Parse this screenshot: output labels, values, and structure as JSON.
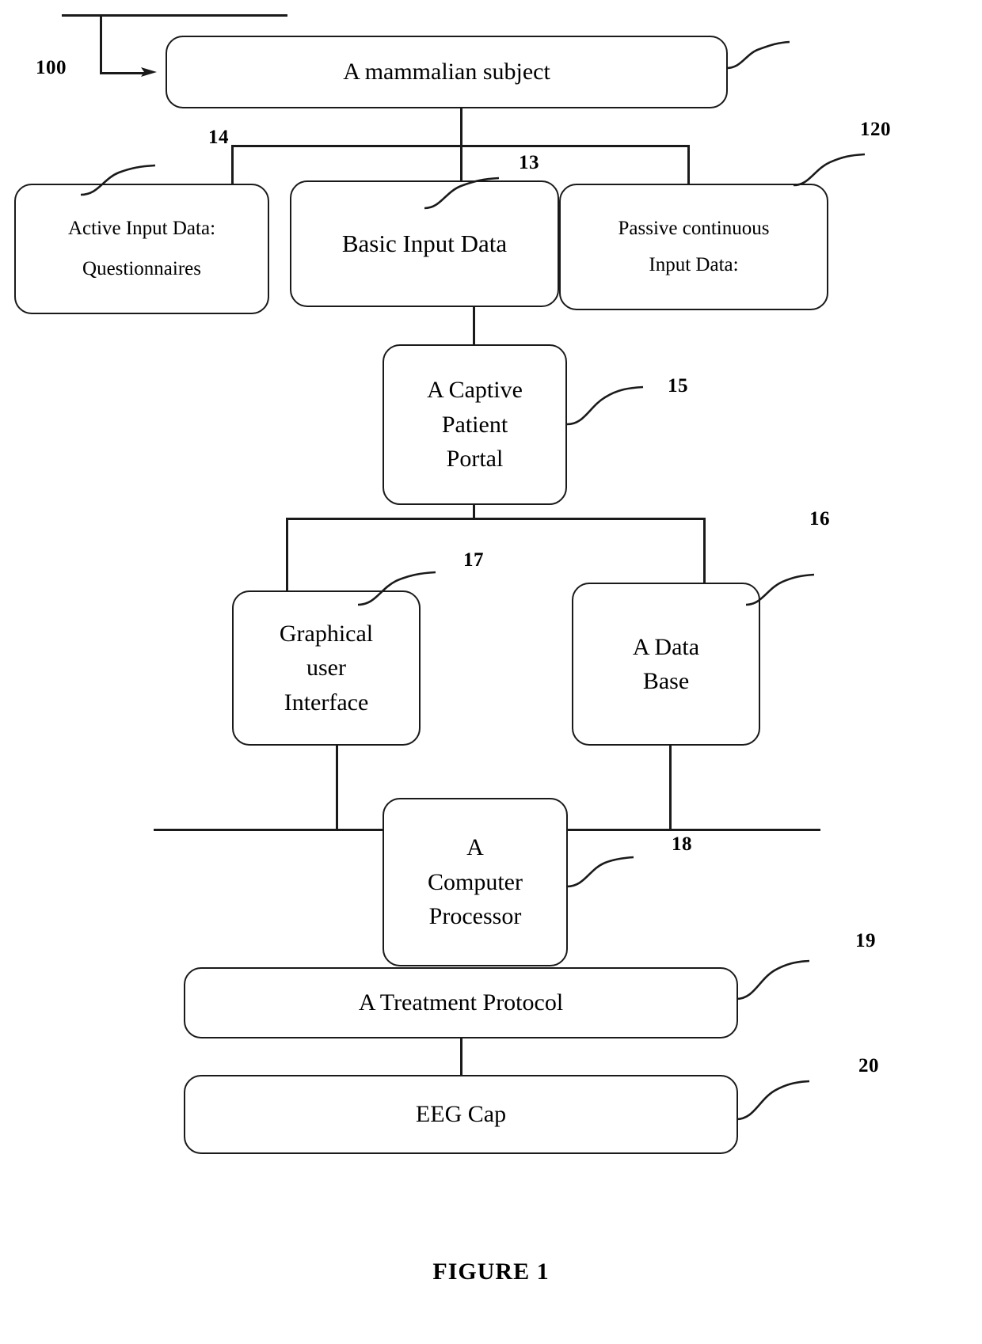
{
  "figure": {
    "caption": "FIGURE 1"
  },
  "nodes": {
    "subject": {
      "label": "A mammalian subject",
      "ref": "100"
    },
    "active_input": {
      "line1": "Active Input Data:",
      "line2": "Questionnaires",
      "ref": "14"
    },
    "basic_input": {
      "label": "Basic Input Data",
      "ref": "13"
    },
    "passive_input": {
      "line1": "Passive continuous",
      "line2": "Input Data:",
      "ref": "120"
    },
    "portal": {
      "line1": "A Captive",
      "line2": "Patient",
      "line3": "Portal",
      "ref": "15"
    },
    "gui": {
      "line1": "Graphical",
      "line2": "user",
      "line3": "Interface",
      "ref": "17"
    },
    "database": {
      "line1": "A Data",
      "line2": "Base",
      "ref": "16"
    },
    "processor": {
      "line1": "A",
      "line2": "Computer",
      "line3": "Processor",
      "ref": "18"
    },
    "treatment": {
      "label": "A Treatment Protocol",
      "ref": "19"
    },
    "eeg": {
      "label": "EEG Cap",
      "ref": "20"
    }
  },
  "colors": {
    "stroke": "#1a1a1a",
    "background": "#ffffff",
    "text": "#000000"
  }
}
